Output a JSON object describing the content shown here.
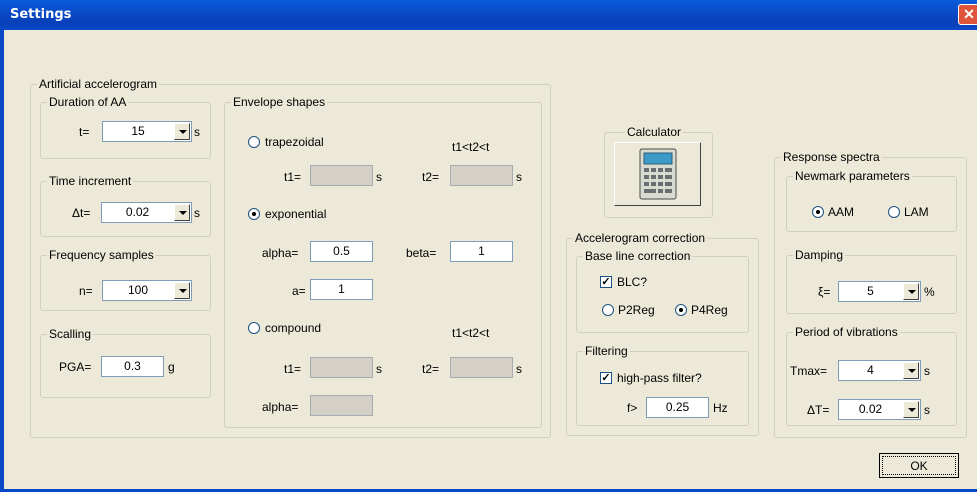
{
  "window": {
    "title": "Settings",
    "close_glyph": "✕"
  },
  "artificial": {
    "title": "Artificial accelerogram",
    "duration": {
      "title": "Duration of AA",
      "label": "t=",
      "value": "15",
      "unit": "s"
    },
    "time_increment": {
      "title": "Time increment",
      "label": "Δt=",
      "value": "0.02",
      "unit": "s"
    },
    "frequency": {
      "title": "Frequency samples",
      "label": "n=",
      "value": "100"
    },
    "scaling": {
      "title": "Scalling",
      "label": "PGA=",
      "value": "0.3",
      "unit": "g"
    },
    "envelope": {
      "title": "Envelope shapes",
      "trapezoidal": {
        "label": "trapezoidal",
        "selected": false,
        "constraint": "t1<t2<t",
        "t1_label": "t1=",
        "t1_value": "",
        "t2_label": "t2=",
        "t2_value": "",
        "unit": "s"
      },
      "exponential": {
        "label": "exponential",
        "selected": true,
        "alpha_label": "alpha=",
        "alpha_value": "0.5",
        "beta_label": "beta=",
        "beta_value": "1",
        "a_label": "a=",
        "a_value": "1"
      },
      "compound": {
        "label": "compound",
        "selected": false,
        "constraint": "t1<t2<t",
        "t1_label": "t1=",
        "t1_value": "",
        "t2_label": "t2=",
        "t2_value": "",
        "unit": "s",
        "alpha_label": "alpha=",
        "alpha_value": ""
      }
    }
  },
  "calculator": {
    "title": "Calculator",
    "icon": "calculator-icon"
  },
  "correction": {
    "title": "Accelerogram correction",
    "baseline": {
      "title": "Base line correction",
      "blc_label": "BLC?",
      "blc_checked": true,
      "p2_label": "P2Reg",
      "p2_selected": false,
      "p4_label": "P4Reg",
      "p4_selected": true
    },
    "filtering": {
      "title": "Filtering",
      "hp_label": "high-pass filter?",
      "hp_checked": true,
      "f_label": "f>",
      "f_value": "0.25",
      "f_unit": "Hz"
    }
  },
  "response": {
    "title": "Response spectra",
    "newmark": {
      "title": "Newmark parameters",
      "aam_label": "AAM",
      "aam_selected": true,
      "lam_label": "LAM",
      "lam_selected": false
    },
    "damping": {
      "title": "Damping",
      "label": "ξ=",
      "value": "5",
      "unit": "%"
    },
    "period": {
      "title": "Period of vibrations",
      "tmax_label": "Tmax=",
      "tmax_value": "4",
      "tmax_unit": "s",
      "dt_label": "ΔT=",
      "dt_value": "0.02",
      "dt_unit": "s"
    }
  },
  "ok_label": "OK",
  "colors": {
    "titlebar": "#0a4ac8",
    "face": "#ece9d8",
    "close": "#e0553a"
  }
}
